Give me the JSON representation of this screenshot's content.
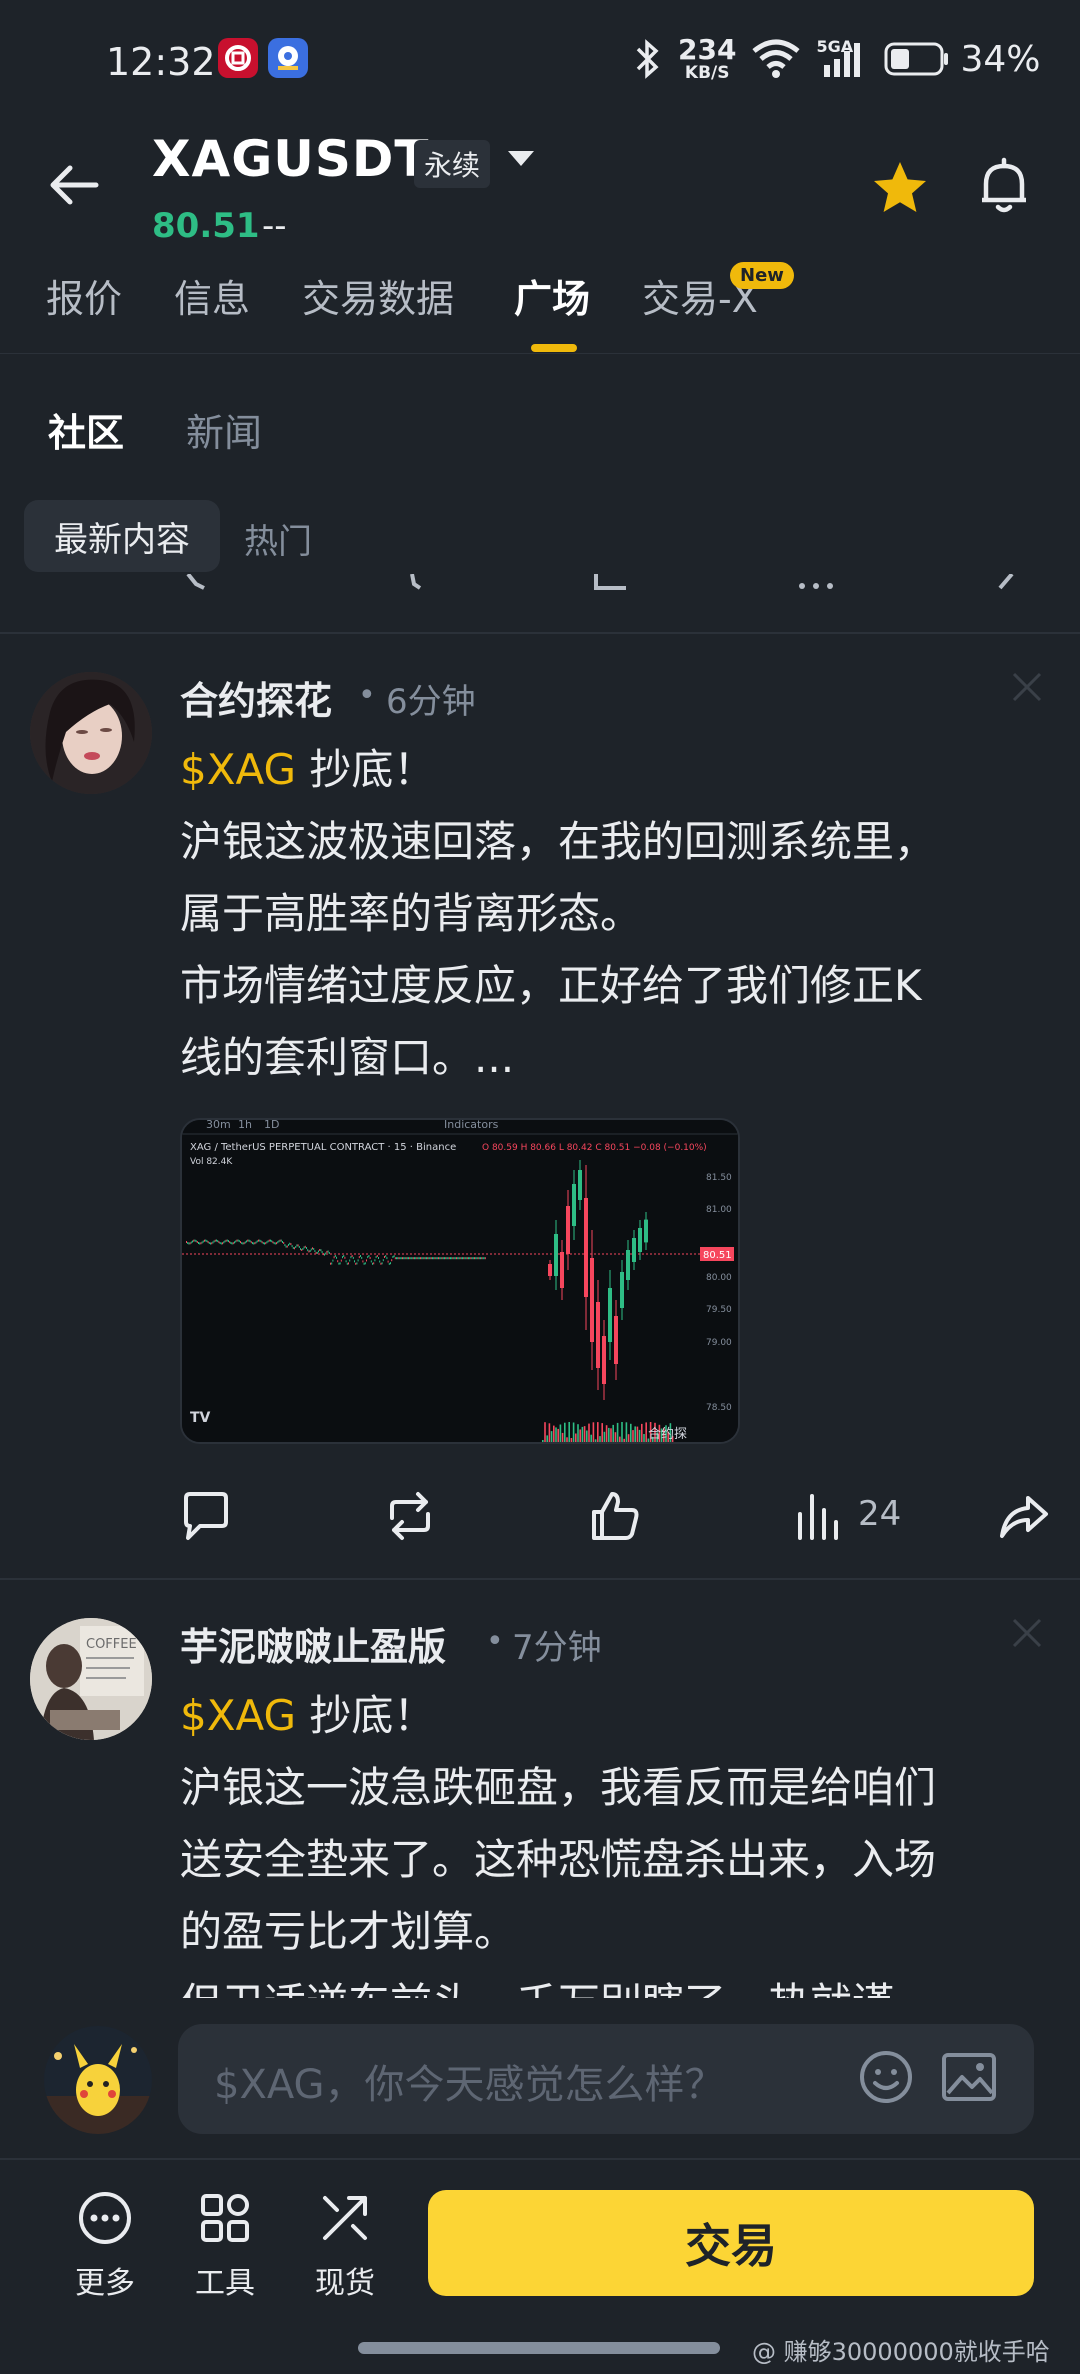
{
  "status_bar": {
    "time": "12:32",
    "net_speed_value": "234",
    "net_speed_unit": "KB/S",
    "signal_label": "5GA",
    "battery": "34%"
  },
  "header": {
    "symbol": "XAGUSDT",
    "contract_tag": "永续",
    "price": "80.51",
    "change": "--"
  },
  "tabs": [
    {
      "label": "报价"
    },
    {
      "label": "信息"
    },
    {
      "label": "交易数据"
    },
    {
      "label": "广场"
    },
    {
      "label": "交易-X"
    }
  ],
  "new_badge": "New",
  "subtabs": [
    {
      "label": "社区"
    },
    {
      "label": "新闻"
    }
  ],
  "filters": [
    {
      "label": "最新内容"
    },
    {
      "label": "热门"
    }
  ],
  "posts": [
    {
      "author": "合约探花",
      "time": "6分钟",
      "cashtag": "$XAG",
      "title_rest": " 抄底！",
      "lines": [
        "沪银这波极速回落，在我的回测系统里，",
        "属于高胜率的背离形态。",
        "市场情绪过度反应，正好给了我们修正K",
        "线的套利窗口。..."
      ],
      "views": "24",
      "chart": {
        "pair_title": "XAG / TetherUS PERPETUAL CONTRACT · 15 · Binance",
        "ohlc": "O 80.59  H 80.66  L 80.42  C 80.51 −0.08 (−0.10%)",
        "vol": "Vol  82.4K",
        "price_tag": "80.51",
        "yticks": [
          "81.50",
          "81.00",
          "80.00",
          "79.50",
          "79.00",
          "78.50"
        ],
        "watermark": "合约探",
        "toolbar": [
          "30m",
          "1h",
          "1D",
          "Indicators"
        ]
      }
    },
    {
      "author": "芋泥啵啵止盈版",
      "time": "7分钟",
      "cashtag": "$XAG",
      "title_rest": " 抄底！",
      "lines": [
        "沪银这一波急跌砸盘，我看反而是给咱们",
        "送安全垫来了。这种恐慌盘杀出来，入场",
        "的盈亏比才划算。",
        "但卫适逆东前头，千万别瞎了一热就谨"
      ]
    }
  ],
  "composer": {
    "placeholder": "$XAG，你今天感觉怎么样？"
  },
  "bottom_nav": [
    {
      "label": "更多",
      "icon": "more-icon"
    },
    {
      "label": "工具",
      "icon": "tools-icon"
    },
    {
      "label": "现货",
      "icon": "spot-icon"
    }
  ],
  "trade_button": "交易",
  "watermark": "@ 赚够30000000就收手哈",
  "colors": {
    "background": "#1e2329",
    "accent": "#f0b90b",
    "up": "#2ebd85",
    "down": "#f6465d",
    "trade_button": "#fcd535"
  }
}
